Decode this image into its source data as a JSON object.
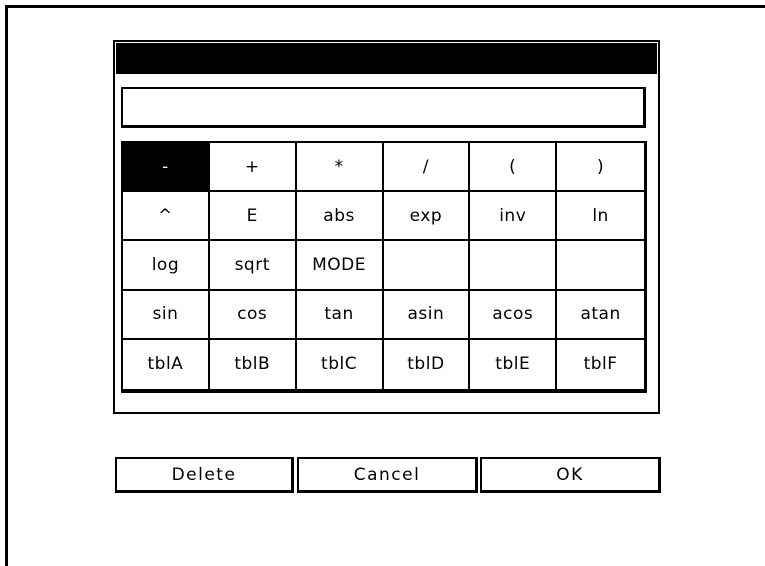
{
  "dialog": {
    "title": "",
    "expression_value": ""
  },
  "keypad": {
    "rows": [
      [
        "-",
        "+",
        "*",
        "/",
        "(",
        ")"
      ],
      [
        "^",
        "E",
        "abs",
        "exp",
        "inv",
        "ln"
      ],
      [
        "log",
        "sqrt",
        "MODE",
        "",
        "",
        ""
      ],
      [
        "sin",
        "cos",
        "tan",
        "asin",
        "acos",
        "atan"
      ],
      [
        "tblA",
        "tblB",
        "tblC",
        "tblD",
        "tblE",
        "tblF"
      ]
    ],
    "selected": "-"
  },
  "buttons": {
    "delete_label": "Delete",
    "cancel_label": "Cancel",
    "ok_label": "OK"
  },
  "colors": {
    "background": "#ffffff",
    "foreground": "#000000",
    "selected_bg": "#000000",
    "selected_fg": "#ffffff"
  }
}
